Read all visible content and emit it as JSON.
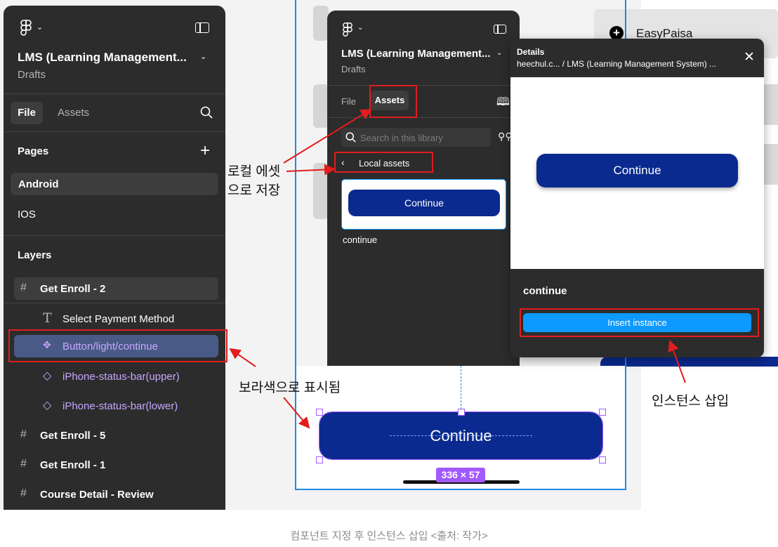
{
  "left_panel": {
    "file_title": "LMS (Learning Management...",
    "drafts": "Drafts",
    "tabs": [
      "File",
      "Assets"
    ],
    "pages_label": "Pages",
    "pages": [
      "Android",
      "IOS"
    ],
    "layers_label": "Layers",
    "layers": [
      {
        "label": "Get Enroll - 2",
        "icon": "frame-icon"
      },
      {
        "label": "Select Payment Method",
        "icon": "text-icon"
      },
      {
        "label": "Button/light/continue",
        "icon": "component-instance-icon"
      },
      {
        "label": "iPhone-status-bar(upper)",
        "icon": "instance-icon"
      },
      {
        "label": "iPhone-status-bar(lower)",
        "icon": "instance-icon"
      },
      {
        "label": "Get Enroll - 5",
        "icon": "frame-icon"
      },
      {
        "label": "Get Enroll - 1",
        "icon": "frame-icon"
      },
      {
        "label": "Course Detail - Review",
        "icon": "frame-icon"
      }
    ]
  },
  "middle_panel": {
    "file_title": "LMS (Learning Management...",
    "drafts": "Drafts",
    "tabs": [
      "File",
      "Assets"
    ],
    "search_placeholder": "Search in this library",
    "local_assets": "Local assets",
    "asset_button": "Continue",
    "asset_name": "continue"
  },
  "details_panel": {
    "title": "Details",
    "path": "heechul.c...  / LMS (Learning Management System) ...",
    "preview_button": "Continue",
    "component_name": "continue",
    "insert_label": "Insert instance"
  },
  "canvas": {
    "top_right_label": "EasyPaisa",
    "button_label": "Continue",
    "size_badge": "336 × 57"
  },
  "annotations": {
    "local_save_line1": "로컬 에셋",
    "local_save_line2": "으로 저장",
    "purple_note": "보라색으로 표시됨",
    "insert_note": "인스턴스 삽입"
  },
  "caption": "컴포넌트 지정 후 인스턴스 삽입 <출처: 작가>",
  "colors": {
    "panel": "#2c2c2c",
    "accent_blue": "#0d99ff",
    "button_navy": "#0b2a8f",
    "selection_purple": "#a259ff",
    "annotation_red": "#e11d1d"
  }
}
